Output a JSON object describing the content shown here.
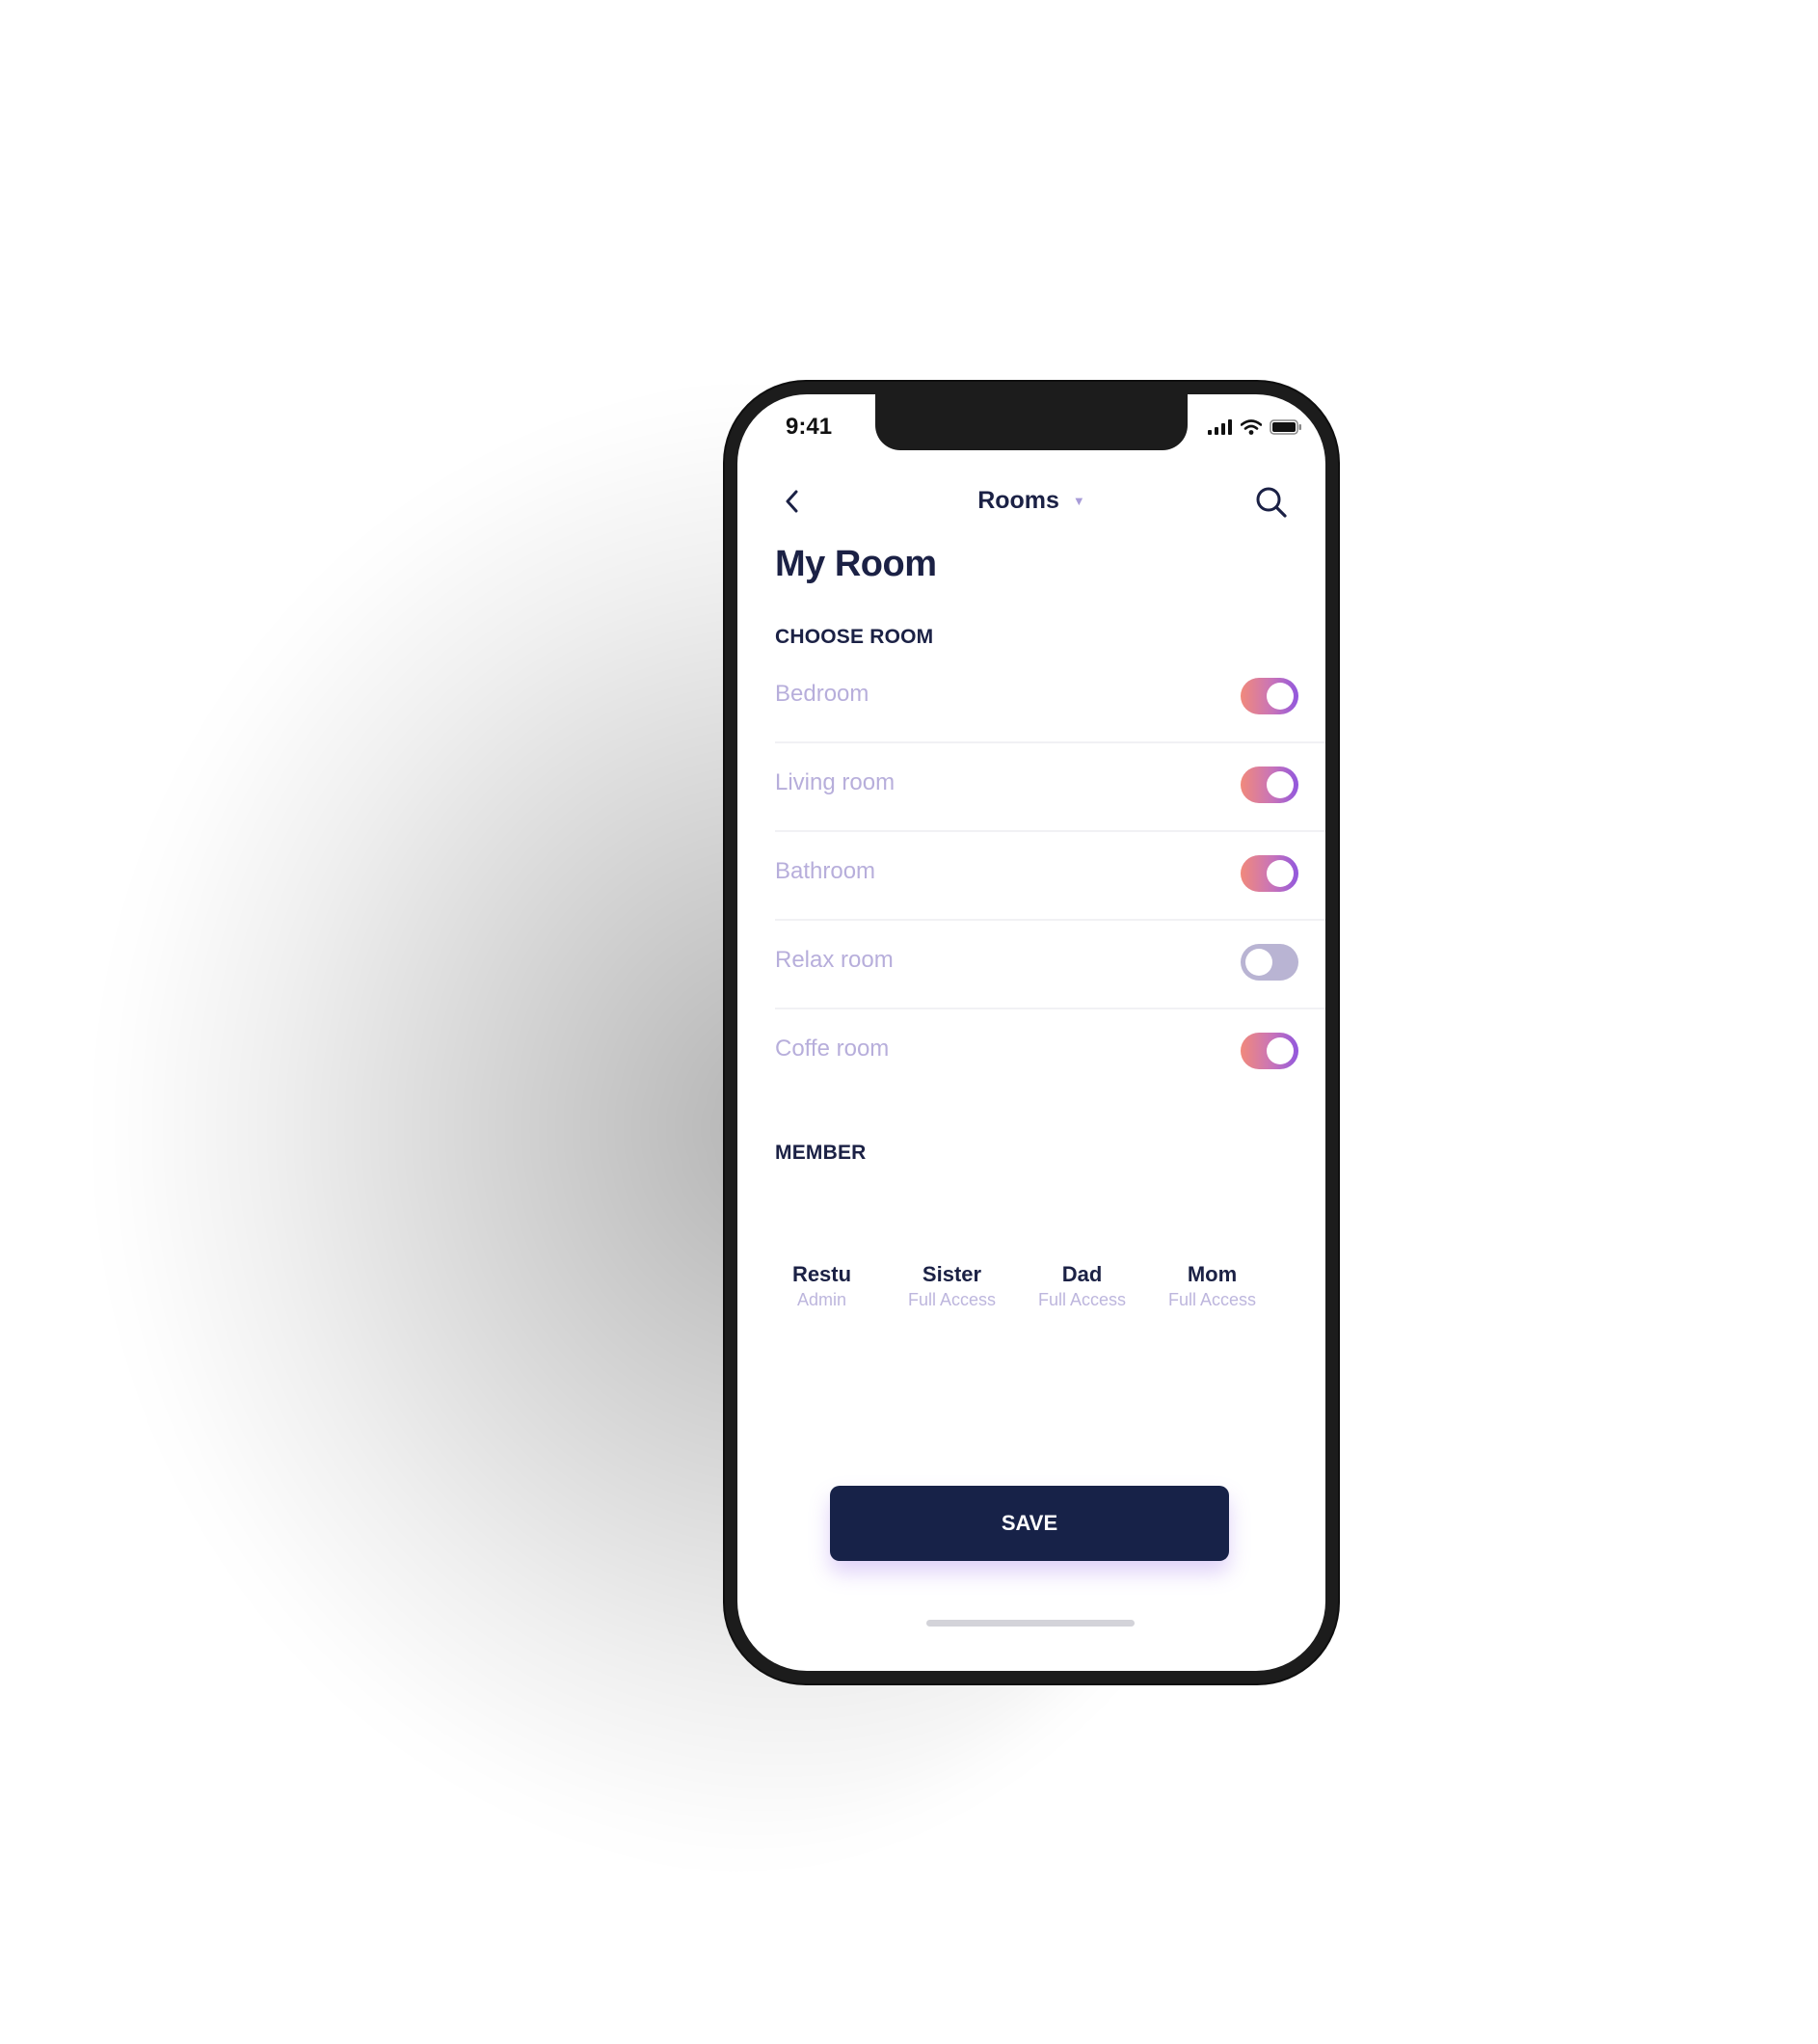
{
  "status_bar": {
    "time": "9:41",
    "icons": [
      "signal-icon",
      "wifi-icon",
      "battery-icon"
    ]
  },
  "nav": {
    "back_icon": "chevron-left-icon",
    "title": "Rooms",
    "caret": "▼",
    "search_icon": "search-icon"
  },
  "page": {
    "title": "My Room"
  },
  "rooms_section": {
    "label": "CHOOSE ROOM",
    "rooms": [
      {
        "label": "Bedroom",
        "on": true
      },
      {
        "label": "Living room",
        "on": true
      },
      {
        "label": "Bathroom",
        "on": true
      },
      {
        "label": "Relax room",
        "on": false
      },
      {
        "label": "Coffe room",
        "on": true
      }
    ]
  },
  "members_section": {
    "label": "MEMBER",
    "members": [
      {
        "name": "Restu",
        "role": "Admin"
      },
      {
        "name": "Sister",
        "role": "Full Access"
      },
      {
        "name": "Dad",
        "role": "Full Access"
      },
      {
        "name": "Mom",
        "role": "Full Access"
      }
    ]
  },
  "save_label": "SAVE",
  "colors": {
    "navy": "#1b2145",
    "button": "#172248",
    "muted_text": "#b7aedb",
    "toggle_on_start": "#f1897b",
    "toggle_on_end": "#9157de",
    "toggle_off": "#b9b4d3"
  }
}
